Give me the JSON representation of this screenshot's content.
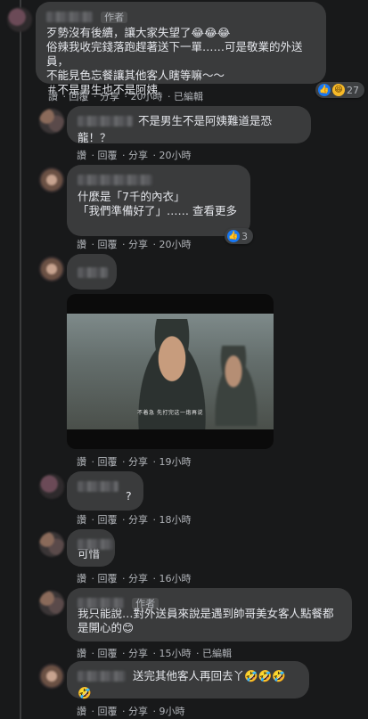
{
  "comments": [
    {
      "author_badge": "作者",
      "text": "歹勢沒有後續，讓大家失望了😂😂😂\n俗辣我收完錢落跑趕著送下一單……可是敬業的外送員，\n不能見色忘餐讓其他客人瞎等嘛～～\n＃不是男生也不是阿姨",
      "actions": [
        "讚",
        "回覆",
        "分享",
        "20小時",
        "已編輯"
      ],
      "reaction_count": "27"
    },
    {
      "text": "不是男生不是阿姨難道是恐龍！？",
      "actions": [
        "讚",
        "回覆",
        "分享",
        "20小時"
      ]
    },
    {
      "text": "什麼是「7千的內衣」\n「我們準備好了」…… 查看更多",
      "actions": [
        "讚",
        "回覆",
        "分享",
        "20小時"
      ],
      "reaction_count": "3"
    },
    {
      "video_subtitle": "不着急 先打完这一炮再说",
      "actions": [
        "讚",
        "回覆",
        "分享",
        "19小時"
      ]
    },
    {
      "text": "?",
      "actions": [
        "讚",
        "回覆",
        "分享",
        "18小時"
      ]
    },
    {
      "text": "可惜",
      "actions": [
        "讚",
        "回覆",
        "分享",
        "16小時"
      ]
    },
    {
      "author_badge": "作者",
      "text": "我只能說…對外送員來說是遇到帥哥美女客人點餐都\n是開心的😊",
      "actions": [
        "讚",
        "回覆",
        "分享",
        "15小時",
        "已編輯"
      ]
    },
    {
      "text": "送完其他客人再回去丫🤣🤣🤣🤣",
      "actions": [
        "讚",
        "回覆",
        "分享",
        "9小時"
      ]
    }
  ],
  "colors": {
    "like": "#1877f2",
    "bg": "#18191a",
    "bubble": "#3a3b3c"
  }
}
